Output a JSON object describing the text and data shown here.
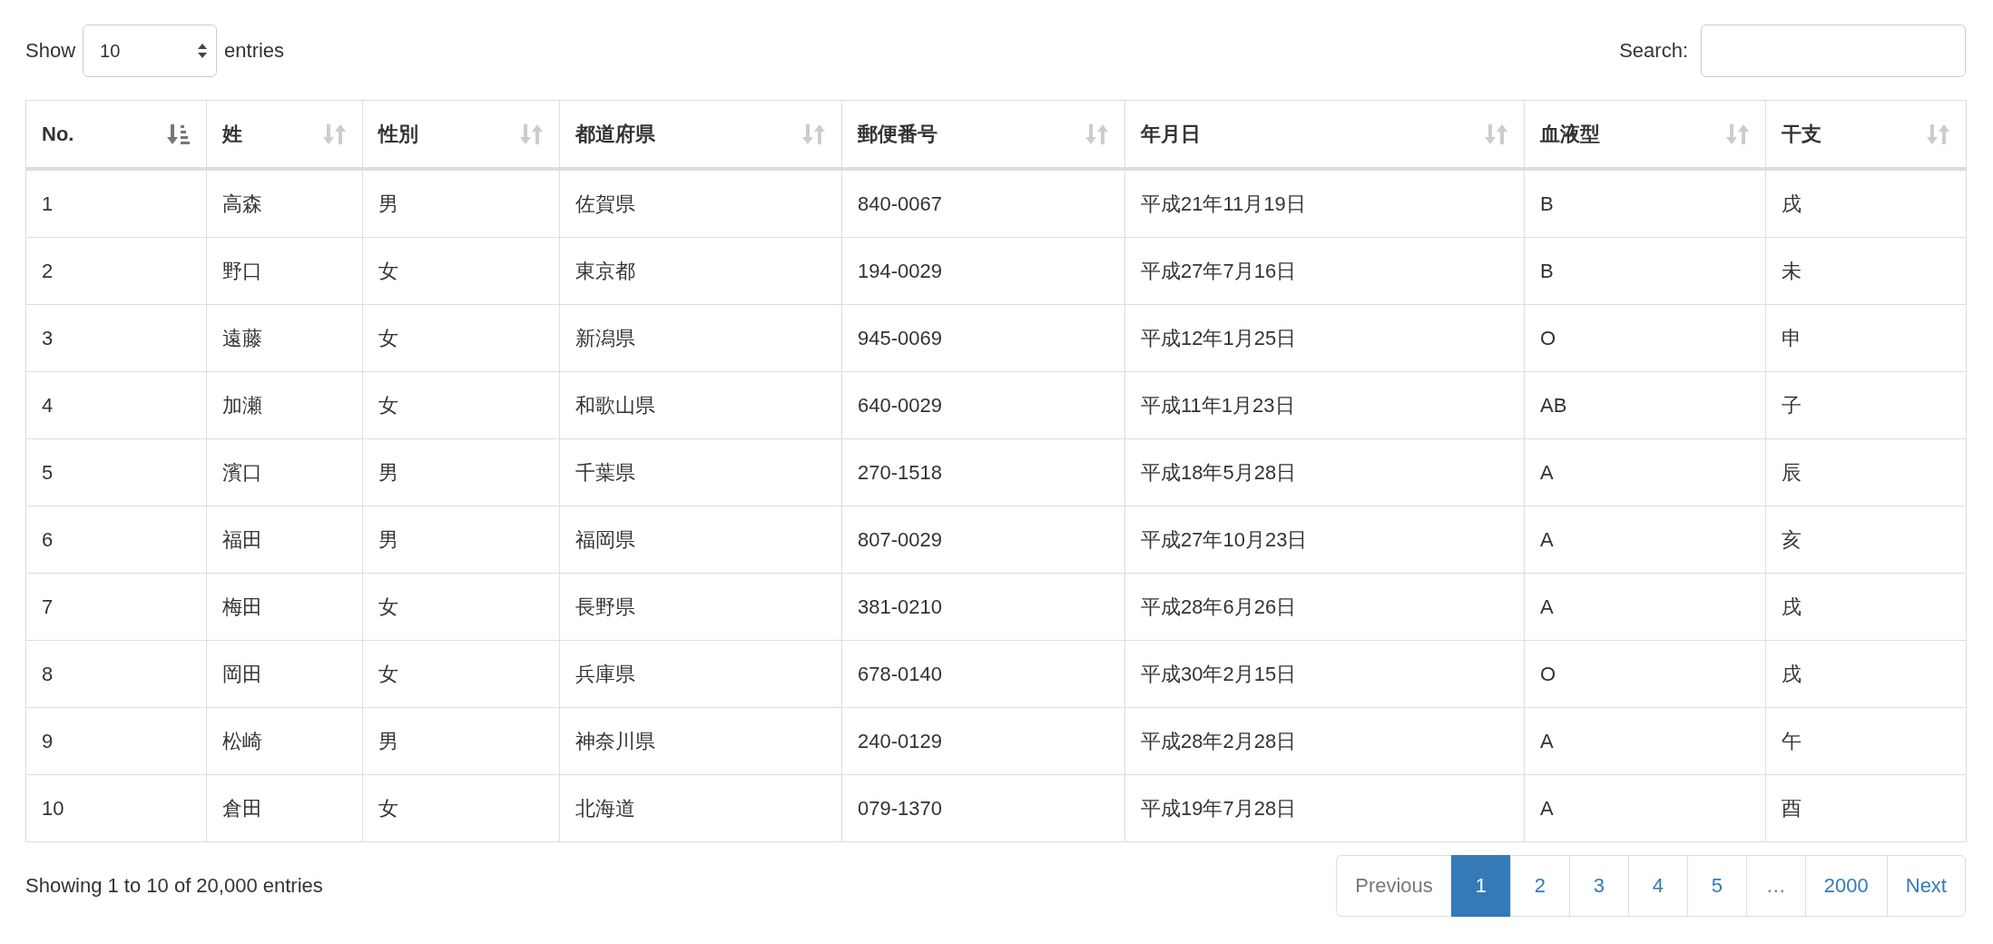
{
  "length_control": {
    "label_before": "Show",
    "value": "10",
    "label_after": "entries"
  },
  "search": {
    "label": "Search:"
  },
  "table": {
    "columns": [
      {
        "label": "No.",
        "sorted": true
      },
      {
        "label": "姓",
        "sorted": false
      },
      {
        "label": "性別",
        "sorted": false
      },
      {
        "label": "都道府県",
        "sorted": false
      },
      {
        "label": "郵便番号",
        "sorted": false
      },
      {
        "label": "年月日",
        "sorted": false
      },
      {
        "label": "血液型",
        "sorted": false
      },
      {
        "label": "干支",
        "sorted": false
      }
    ],
    "rows": [
      [
        "1",
        "高森",
        "男",
        "佐賀県",
        "840-0067",
        "平成21年11月19日",
        "B",
        "戌"
      ],
      [
        "2",
        "野口",
        "女",
        "東京都",
        "194-0029",
        "平成27年7月16日",
        "B",
        "未"
      ],
      [
        "3",
        "遠藤",
        "女",
        "新潟県",
        "945-0069",
        "平成12年1月25日",
        "O",
        "申"
      ],
      [
        "4",
        "加瀬",
        "女",
        "和歌山県",
        "640-0029",
        "平成11年1月23日",
        "AB",
        "子"
      ],
      [
        "5",
        "濱口",
        "男",
        "千葉県",
        "270-1518",
        "平成18年5月28日",
        "A",
        "辰"
      ],
      [
        "6",
        "福田",
        "男",
        "福岡県",
        "807-0029",
        "平成27年10月23日",
        "A",
        "亥"
      ],
      [
        "7",
        "梅田",
        "女",
        "長野県",
        "381-0210",
        "平成28年6月26日",
        "A",
        "戌"
      ],
      [
        "8",
        "岡田",
        "女",
        "兵庫県",
        "678-0140",
        "平成30年2月15日",
        "O",
        "戌"
      ],
      [
        "9",
        "松崎",
        "男",
        "神奈川県",
        "240-0129",
        "平成28年2月28日",
        "A",
        "午"
      ],
      [
        "10",
        "倉田",
        "女",
        "北海道",
        "079-1370",
        "平成19年7月28日",
        "A",
        "酉"
      ]
    ]
  },
  "info": "Showing 1 to 10 of 20,000 entries",
  "pagination": [
    {
      "label": "Previous",
      "selected": false,
      "disabled": true
    },
    {
      "label": "1",
      "selected": true,
      "disabled": false
    },
    {
      "label": "2",
      "selected": false,
      "disabled": false
    },
    {
      "label": "3",
      "selected": false,
      "disabled": false
    },
    {
      "label": "4",
      "selected": false,
      "disabled": false
    },
    {
      "label": "5",
      "selected": false,
      "disabled": false
    },
    {
      "label": "…",
      "selected": false,
      "disabled": true
    },
    {
      "label": "2000",
      "selected": false,
      "disabled": false
    },
    {
      "label": "Next",
      "selected": false,
      "disabled": false
    }
  ]
}
